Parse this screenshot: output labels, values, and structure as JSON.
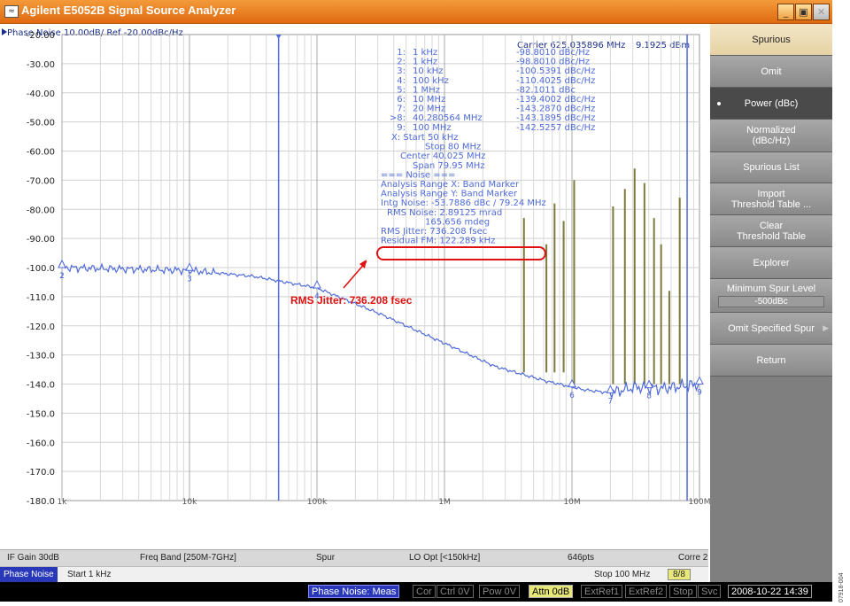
{
  "window": {
    "title": "Agilent E5052B Signal Source Analyzer",
    "min_label": "_",
    "max_label": "▣",
    "close_label": "✕"
  },
  "trace": {
    "header": "Phase Noise 10.00dB/ Ref -20.00dBc/Hz",
    "carrier": "Carrier 625.035896 MHz",
    "carrier_power": "9.1925 dBm",
    "trace_color": "#4f6bd8",
    "spur_color": "#7d7a3a"
  },
  "markers": [
    {
      "id": "1:",
      "freq": "1 kHz",
      "value": "-98.8010 dBc/Hz"
    },
    {
      "id": "2:",
      "freq": "1 kHz",
      "value": "-98.8010 dBc/Hz"
    },
    {
      "id": "3:",
      "freq": "10 kHz",
      "value": "-100.5391 dBc/Hz"
    },
    {
      "id": "4:",
      "freq": "100 kHz",
      "value": "-110.4025 dBc/Hz"
    },
    {
      "id": "5:",
      "freq": "1 MHz",
      "value": "-82.1011 dBc"
    },
    {
      "id": "6:",
      "freq": "10 MHz",
      "value": "-139.4002 dBc/Hz"
    },
    {
      "id": "7:",
      "freq": "20 MHz",
      "value": "-143.2870 dBc/Hz"
    },
    {
      "id": ">8:",
      "freq": "40.280564 MHz",
      "value": "-143.1895 dBc/Hz"
    },
    {
      "id": "9:",
      "freq": "100 MHz",
      "value": "-142.5257 dBc/Hz"
    }
  ],
  "analysis_lines": [
    "X: Start 50 kHz",
    "Stop 80 MHz",
    "Center 40.025 MHz",
    "Span 79.95 MHz",
    "=== Noise ===",
    "Analysis Range X: Band Marker",
    "Analysis Range Y: Band Marker",
    "Intg Noise: -53.7886 dBc / 79.24 MHz",
    "RMS Noise: 2.89125 mrad",
    "165.656 mdeg",
    "RMS Jitter: 736.208 fsec",
    "Residual FM: 122.289 kHz"
  ],
  "annotation": {
    "text": "RMS Jitter: 736.208 fsec",
    "color": "#e01010"
  },
  "y_axis": {
    "ticks": [
      "-20.00",
      "-30.00",
      "-40.00",
      "-50.00",
      "-60.00",
      "-70.00",
      "-80.00",
      "-90.00",
      "-100.0",
      "-110.0",
      "-120.0",
      "-130.0",
      "-140.0",
      "-150.0",
      "-160.0",
      "-170.0",
      "-180.0"
    ]
  },
  "x_axis": {
    "decade_labels": [
      "1k",
      "10k",
      "100k",
      "1M",
      "10M",
      "100M"
    ]
  },
  "softkeys": [
    {
      "label": "Spurious",
      "value": ""
    },
    {
      "label": "Omit",
      "value": ""
    },
    {
      "label": "Power (dBc)",
      "value": ""
    },
    {
      "label": "Normalized\n(dBc/Hz)",
      "value": ""
    },
    {
      "label": "Spurious List",
      "value": ""
    },
    {
      "label": "Import\nThreshold Table ...",
      "value": ""
    },
    {
      "label": "Clear\nThreshold Table",
      "value": ""
    },
    {
      "label": "Explorer",
      "value": ""
    },
    {
      "label": "Minimum Spur Level",
      "value": "-500dBc"
    },
    {
      "label": "Omit Specified Spur",
      "value": ""
    },
    {
      "label": "Return",
      "value": ""
    }
  ],
  "status1": {
    "if_gain": "IF Gain 30dB",
    "freq_band": "Freq Band [250M-7GHz]",
    "spur": "Spur",
    "lo_opt": "LO Opt [<150kHz]",
    "points": "646pts",
    "corr": "Corre 2"
  },
  "status2": {
    "mode": "Phase Noise",
    "start": "Start 1 kHz",
    "stop": "Stop 100 MHz",
    "page": "8/8"
  },
  "bottombar": {
    "meas": "Phase Noise: Meas",
    "cor": "Cor",
    "ctrl": "Ctrl 0V",
    "pow": "Pow 0V",
    "attn": "Attn 0dB",
    "extref1": "ExtRef1",
    "extref2": "ExtRef2",
    "stop": "Stop",
    "svc": "Svc",
    "datetime": "2008-10-22 14:39"
  },
  "figure_id": "07918-004"
}
